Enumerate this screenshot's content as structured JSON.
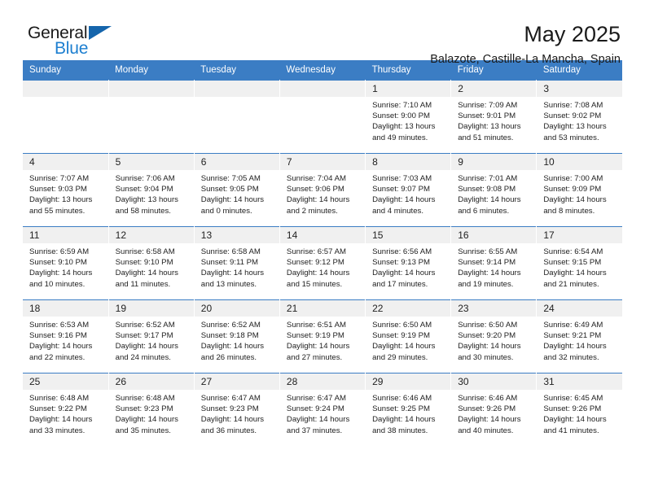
{
  "logo": {
    "word_top": "General",
    "word_bottom": "Blue",
    "accent_color": "#1565ac",
    "blue_text_color": "#1d7fd0"
  },
  "header": {
    "title": "May 2025",
    "subtitle": "Balazote, Castille-La Mancha, Spain"
  },
  "calendar": {
    "header_bg": "#3b7dc4",
    "daynum_bg": "#f0f0f0",
    "weekday_names": [
      "Sunday",
      "Monday",
      "Tuesday",
      "Wednesday",
      "Thursday",
      "Friday",
      "Saturday"
    ],
    "weeks": [
      [
        {
          "day": "",
          "lines": [
            "",
            "",
            "",
            ""
          ]
        },
        {
          "day": "",
          "lines": [
            "",
            "",
            "",
            ""
          ]
        },
        {
          "day": "",
          "lines": [
            "",
            "",
            "",
            ""
          ]
        },
        {
          "day": "",
          "lines": [
            "",
            "",
            "",
            ""
          ]
        },
        {
          "day": "1",
          "lines": [
            "Sunrise: 7:10 AM",
            "Sunset: 9:00 PM",
            "Daylight: 13 hours",
            "and 49 minutes."
          ]
        },
        {
          "day": "2",
          "lines": [
            "Sunrise: 7:09 AM",
            "Sunset: 9:01 PM",
            "Daylight: 13 hours",
            "and 51 minutes."
          ]
        },
        {
          "day": "3",
          "lines": [
            "Sunrise: 7:08 AM",
            "Sunset: 9:02 PM",
            "Daylight: 13 hours",
            "and 53 minutes."
          ]
        }
      ],
      [
        {
          "day": "4",
          "lines": [
            "Sunrise: 7:07 AM",
            "Sunset: 9:03 PM",
            "Daylight: 13 hours",
            "and 55 minutes."
          ]
        },
        {
          "day": "5",
          "lines": [
            "Sunrise: 7:06 AM",
            "Sunset: 9:04 PM",
            "Daylight: 13 hours",
            "and 58 minutes."
          ]
        },
        {
          "day": "6",
          "lines": [
            "Sunrise: 7:05 AM",
            "Sunset: 9:05 PM",
            "Daylight: 14 hours",
            "and 0 minutes."
          ]
        },
        {
          "day": "7",
          "lines": [
            "Sunrise: 7:04 AM",
            "Sunset: 9:06 PM",
            "Daylight: 14 hours",
            "and 2 minutes."
          ]
        },
        {
          "day": "8",
          "lines": [
            "Sunrise: 7:03 AM",
            "Sunset: 9:07 PM",
            "Daylight: 14 hours",
            "and 4 minutes."
          ]
        },
        {
          "day": "9",
          "lines": [
            "Sunrise: 7:01 AM",
            "Sunset: 9:08 PM",
            "Daylight: 14 hours",
            "and 6 minutes."
          ]
        },
        {
          "day": "10",
          "lines": [
            "Sunrise: 7:00 AM",
            "Sunset: 9:09 PM",
            "Daylight: 14 hours",
            "and 8 minutes."
          ]
        }
      ],
      [
        {
          "day": "11",
          "lines": [
            "Sunrise: 6:59 AM",
            "Sunset: 9:10 PM",
            "Daylight: 14 hours",
            "and 10 minutes."
          ]
        },
        {
          "day": "12",
          "lines": [
            "Sunrise: 6:58 AM",
            "Sunset: 9:10 PM",
            "Daylight: 14 hours",
            "and 11 minutes."
          ]
        },
        {
          "day": "13",
          "lines": [
            "Sunrise: 6:58 AM",
            "Sunset: 9:11 PM",
            "Daylight: 14 hours",
            "and 13 minutes."
          ]
        },
        {
          "day": "14",
          "lines": [
            "Sunrise: 6:57 AM",
            "Sunset: 9:12 PM",
            "Daylight: 14 hours",
            "and 15 minutes."
          ]
        },
        {
          "day": "15",
          "lines": [
            "Sunrise: 6:56 AM",
            "Sunset: 9:13 PM",
            "Daylight: 14 hours",
            "and 17 minutes."
          ]
        },
        {
          "day": "16",
          "lines": [
            "Sunrise: 6:55 AM",
            "Sunset: 9:14 PM",
            "Daylight: 14 hours",
            "and 19 minutes."
          ]
        },
        {
          "day": "17",
          "lines": [
            "Sunrise: 6:54 AM",
            "Sunset: 9:15 PM",
            "Daylight: 14 hours",
            "and 21 minutes."
          ]
        }
      ],
      [
        {
          "day": "18",
          "lines": [
            "Sunrise: 6:53 AM",
            "Sunset: 9:16 PM",
            "Daylight: 14 hours",
            "and 22 minutes."
          ]
        },
        {
          "day": "19",
          "lines": [
            "Sunrise: 6:52 AM",
            "Sunset: 9:17 PM",
            "Daylight: 14 hours",
            "and 24 minutes."
          ]
        },
        {
          "day": "20",
          "lines": [
            "Sunrise: 6:52 AM",
            "Sunset: 9:18 PM",
            "Daylight: 14 hours",
            "and 26 minutes."
          ]
        },
        {
          "day": "21",
          "lines": [
            "Sunrise: 6:51 AM",
            "Sunset: 9:19 PM",
            "Daylight: 14 hours",
            "and 27 minutes."
          ]
        },
        {
          "day": "22",
          "lines": [
            "Sunrise: 6:50 AM",
            "Sunset: 9:19 PM",
            "Daylight: 14 hours",
            "and 29 minutes."
          ]
        },
        {
          "day": "23",
          "lines": [
            "Sunrise: 6:50 AM",
            "Sunset: 9:20 PM",
            "Daylight: 14 hours",
            "and 30 minutes."
          ]
        },
        {
          "day": "24",
          "lines": [
            "Sunrise: 6:49 AM",
            "Sunset: 9:21 PM",
            "Daylight: 14 hours",
            "and 32 minutes."
          ]
        }
      ],
      [
        {
          "day": "25",
          "lines": [
            "Sunrise: 6:48 AM",
            "Sunset: 9:22 PM",
            "Daylight: 14 hours",
            "and 33 minutes."
          ]
        },
        {
          "day": "26",
          "lines": [
            "Sunrise: 6:48 AM",
            "Sunset: 9:23 PM",
            "Daylight: 14 hours",
            "and 35 minutes."
          ]
        },
        {
          "day": "27",
          "lines": [
            "Sunrise: 6:47 AM",
            "Sunset: 9:23 PM",
            "Daylight: 14 hours",
            "and 36 minutes."
          ]
        },
        {
          "day": "28",
          "lines": [
            "Sunrise: 6:47 AM",
            "Sunset: 9:24 PM",
            "Daylight: 14 hours",
            "and 37 minutes."
          ]
        },
        {
          "day": "29",
          "lines": [
            "Sunrise: 6:46 AM",
            "Sunset: 9:25 PM",
            "Daylight: 14 hours",
            "and 38 minutes."
          ]
        },
        {
          "day": "30",
          "lines": [
            "Sunrise: 6:46 AM",
            "Sunset: 9:26 PM",
            "Daylight: 14 hours",
            "and 40 minutes."
          ]
        },
        {
          "day": "31",
          "lines": [
            "Sunrise: 6:45 AM",
            "Sunset: 9:26 PM",
            "Daylight: 14 hours",
            "and 41 minutes."
          ]
        }
      ]
    ]
  }
}
